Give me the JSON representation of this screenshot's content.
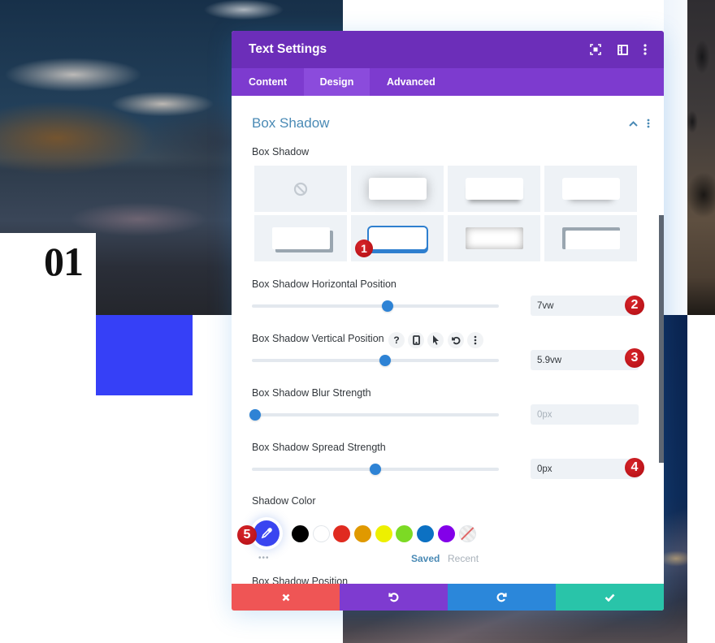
{
  "background": {
    "page_number": "01",
    "blue_square_color": "#3640f7"
  },
  "modal": {
    "title": "Text Settings",
    "header_icons": [
      "expand-icon",
      "split-view-icon",
      "more-options-icon"
    ],
    "tabs": [
      {
        "label": "Content",
        "active": false
      },
      {
        "label": "Design",
        "active": true
      },
      {
        "label": "Advanced",
        "active": false
      }
    ],
    "section": {
      "title": "Box Shadow",
      "icons": [
        "chevron-up-icon",
        "more-options-icon"
      ]
    },
    "box_shadow": {
      "label": "Box Shadow",
      "presets": [
        "none",
        "preset-1",
        "preset-2",
        "preset-3",
        "preset-4",
        "preset-5",
        "preset-6",
        "preset-7"
      ],
      "selected_index": 5
    },
    "sliders": [
      {
        "label": "Box Shadow Horizontal Position",
        "value": "7vw",
        "placeholder": "",
        "fraction": 0.55
      },
      {
        "label": "Box Shadow Vertical Position",
        "value": "5.9vw",
        "placeholder": "",
        "fraction": 0.54,
        "option_icons": [
          "help-icon",
          "responsive-phone-icon",
          "hover-cursor-icon",
          "reset-icon",
          "more-options-icon"
        ],
        "help_glyph": "?"
      },
      {
        "label": "Box Shadow Blur Strength",
        "value": "",
        "placeholder": "0px",
        "fraction": 0.0
      },
      {
        "label": "Box Shadow Spread Strength",
        "value": "0px",
        "placeholder": "",
        "fraction": 0.5
      }
    ],
    "shadow_color": {
      "label": "Shadow Color",
      "current_color": "#3a45f0",
      "swatches": [
        "#000000",
        "#ffffff",
        "#e02b20",
        "#e09900",
        "#edf000",
        "#7cda24",
        "#0c71c3",
        "#8300e9",
        "transparent"
      ],
      "more_label": "•••",
      "palette_tabs": [
        {
          "label": "Saved",
          "active": true
        },
        {
          "label": "Recent",
          "active": false
        }
      ]
    },
    "next_field_label": "Box Shadow Position",
    "footer": {
      "buttons": [
        {
          "name": "cancel",
          "icon": "close-icon",
          "color": "#ef5555"
        },
        {
          "name": "undo",
          "icon": "undo-icon",
          "color": "#7e3bd0"
        },
        {
          "name": "redo",
          "icon": "redo-icon",
          "color": "#2b87da"
        },
        {
          "name": "save",
          "icon": "check-icon",
          "color": "#29c4a9"
        }
      ]
    }
  },
  "annotations": [
    {
      "number": "1",
      "target": "box-shadow-preset-selected"
    },
    {
      "number": "2",
      "target": "horizontal-position-input"
    },
    {
      "number": "3",
      "target": "vertical-position-input"
    },
    {
      "number": "4",
      "target": "spread-strength-input"
    },
    {
      "number": "5",
      "target": "shadow-color-picker"
    }
  ]
}
